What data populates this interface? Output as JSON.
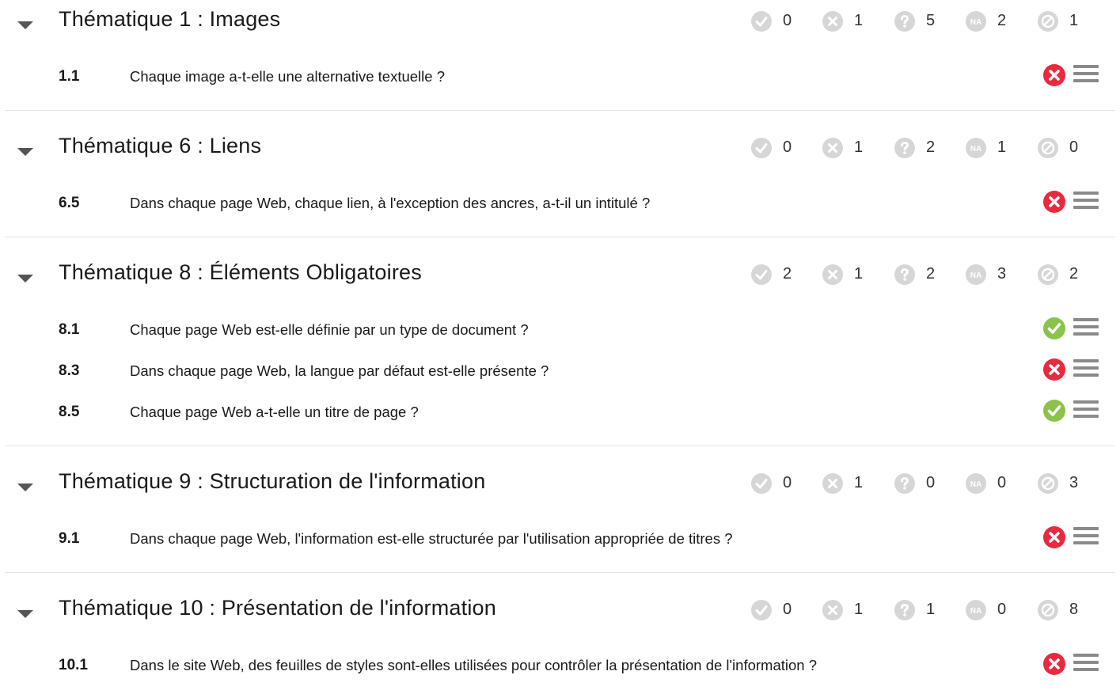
{
  "count_labels": [
    "Conforme",
    "Non conforme",
    "À vérifier",
    "Non applicable",
    "Non testé"
  ],
  "colors": {
    "passed": "#8bc34a",
    "failed": "#e8293f",
    "count_icon": "#d6d6d6",
    "menu": "#8a8a8a"
  },
  "themes": [
    {
      "title": "Thématique 1 : Images",
      "counts": [
        "0",
        "1",
        "5",
        "2",
        "1"
      ],
      "criteria": [
        {
          "number": "1.1",
          "text": "Chaque image a-t-elle une alternative textuelle ?",
          "status": "failed"
        }
      ]
    },
    {
      "title": "Thématique 6 : Liens",
      "counts": [
        "0",
        "1",
        "2",
        "1",
        "0"
      ],
      "criteria": [
        {
          "number": "6.5",
          "text": "Dans chaque page Web, chaque lien, à l'exception des ancres, a-t-il un intitulé ?",
          "status": "failed"
        }
      ]
    },
    {
      "title": "Thématique 8 : Éléments Obligatoires",
      "counts": [
        "2",
        "1",
        "2",
        "3",
        "2"
      ],
      "criteria": [
        {
          "number": "8.1",
          "text": "Chaque page Web est-elle définie par un type de document ?",
          "status": "passed"
        },
        {
          "number": "8.3",
          "text": "Dans chaque page Web, la langue par défaut est-elle présente ?",
          "status": "failed"
        },
        {
          "number": "8.5",
          "text": "Chaque page Web a-t-elle un titre de page ?",
          "status": "passed"
        }
      ]
    },
    {
      "title": "Thématique 9 : Structuration de l'information",
      "counts": [
        "0",
        "1",
        "0",
        "0",
        "3"
      ],
      "criteria": [
        {
          "number": "9.1",
          "text": "Dans chaque page Web, l'information est-elle structurée par l'utilisation appropriée de titres ?",
          "status": "failed"
        }
      ]
    },
    {
      "title": "Thématique 10 : Présentation de l'information",
      "counts": [
        "0",
        "1",
        "1",
        "0",
        "8"
      ],
      "criteria": [
        {
          "number": "10.1",
          "text": "Dans le site Web, des feuilles de styles sont-elles utilisées pour contrôler la présentation de l'information ?",
          "status": "failed"
        }
      ]
    }
  ]
}
